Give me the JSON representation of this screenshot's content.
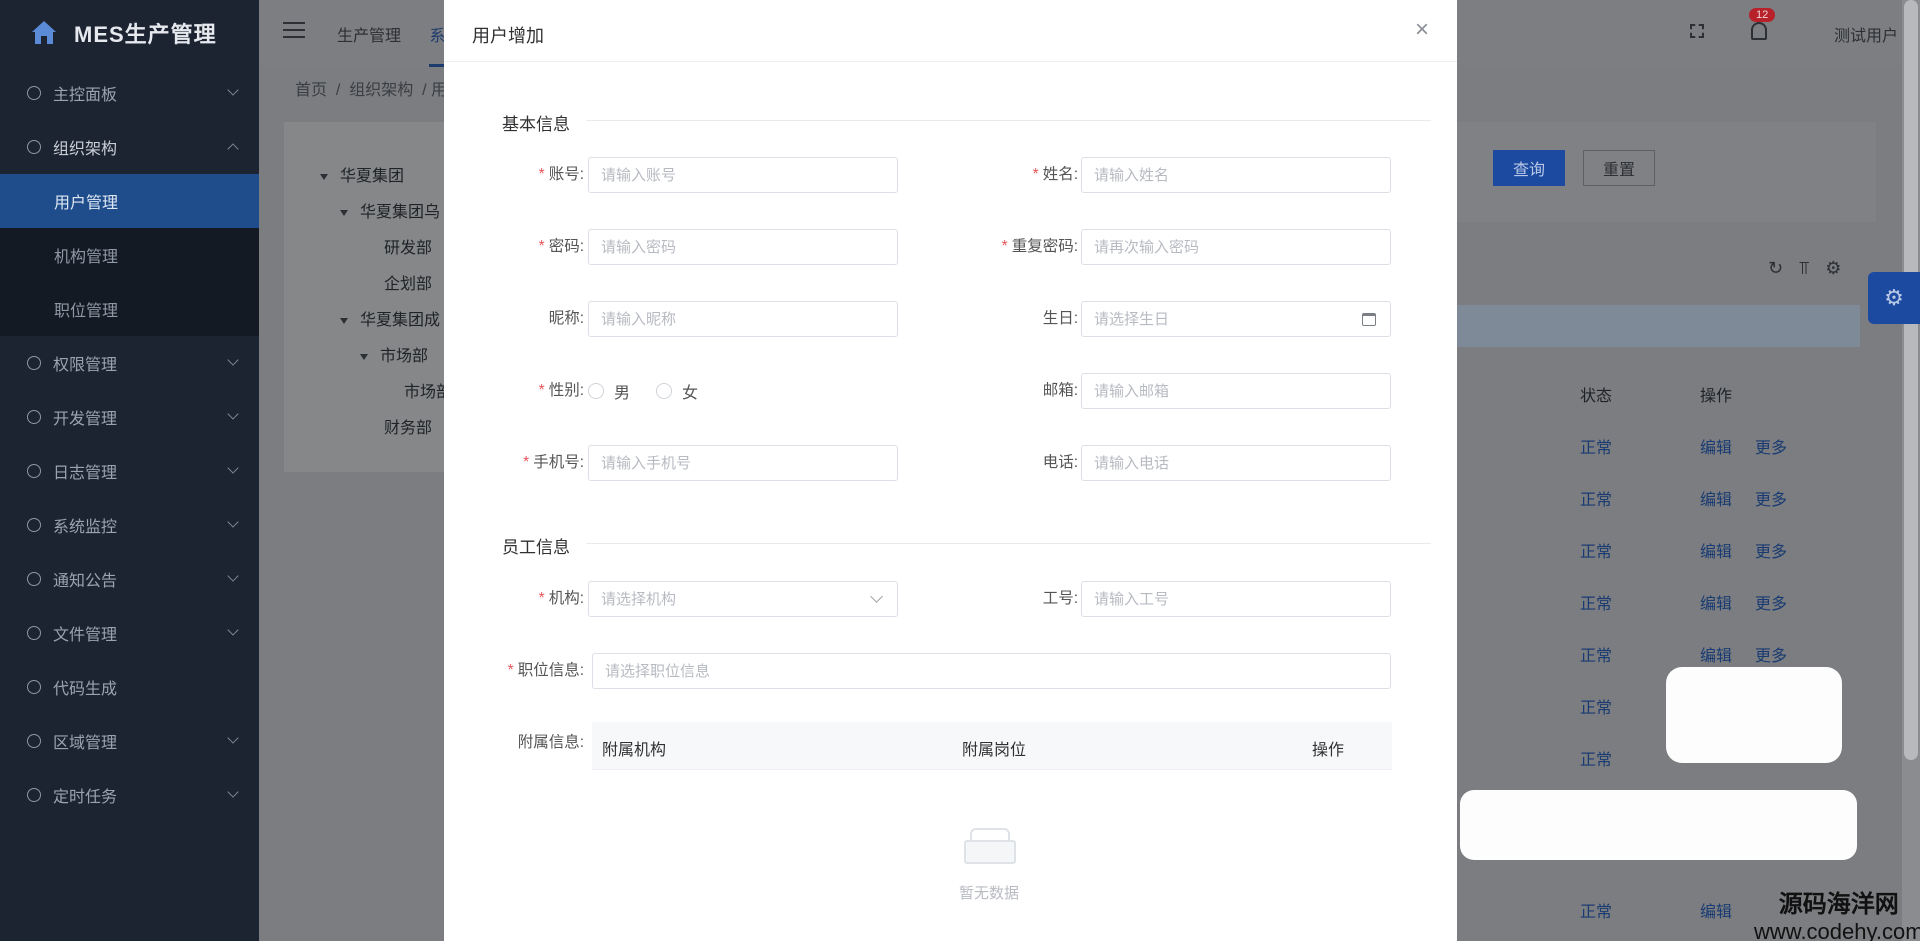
{
  "app": {
    "title": "MES生产管理"
  },
  "sidebar": {
    "items": [
      {
        "label": "主控面板",
        "icon": "dashboard-icon"
      },
      {
        "label": "组织架构",
        "icon": "org-icon",
        "open": true,
        "children": [
          {
            "label": "用户管理",
            "active": true
          },
          {
            "label": "机构管理"
          },
          {
            "label": "职位管理"
          }
        ]
      },
      {
        "label": "权限管理",
        "icon": "shield-icon"
      },
      {
        "label": "开发管理",
        "icon": "dev-icon"
      },
      {
        "label": "日志管理",
        "icon": "log-icon"
      },
      {
        "label": "系统监控",
        "icon": "monitor-icon"
      },
      {
        "label": "通知公告",
        "icon": "notice-icon"
      },
      {
        "label": "文件管理",
        "icon": "file-icon"
      },
      {
        "label": "代码生成",
        "icon": "code-icon"
      },
      {
        "label": "区域管理",
        "icon": "location-icon"
      },
      {
        "label": "定时任务",
        "icon": "clock-icon"
      }
    ]
  },
  "topbar": {
    "nav": [
      "生产管理",
      "系统"
    ],
    "badge_count": "12",
    "user": "测试用户"
  },
  "breadcrumb": {
    "home": "首页",
    "sep": "/",
    "current": "组织架构",
    "tail": "/  用"
  },
  "tree": [
    "华夏集团",
    "华夏集团乌",
    "研发部",
    "企划部",
    "华夏集团成",
    "市场部",
    "市场部",
    "财务部"
  ],
  "filter": {
    "query": "查询",
    "reset": "重置"
  },
  "table": {
    "status_header": "状态",
    "action_header": "操作",
    "status": "正常",
    "edit": "编辑",
    "more": "更多"
  },
  "watermark": {
    "line1": "源码海洋网",
    "line2": "www.codehy.com"
  },
  "modal": {
    "title": "用户增加",
    "close": "×",
    "sections": {
      "basic": "基本信息",
      "employee": "员工信息"
    },
    "fields": {
      "account": {
        "label": "账号:",
        "placeholder": "请输入账号"
      },
      "name": {
        "label": "姓名:",
        "placeholder": "请输入姓名"
      },
      "password": {
        "label": "密码:",
        "placeholder": "请输入密码"
      },
      "repeat_password": {
        "label": "重复密码:",
        "placeholder": "请再次输入密码"
      },
      "nickname": {
        "label": "昵称:",
        "placeholder": "请输入昵称"
      },
      "birthday": {
        "label": "生日:",
        "placeholder": "请选择生日"
      },
      "gender": {
        "label": "性别:",
        "male": "男",
        "female": "女"
      },
      "email": {
        "label": "邮箱:",
        "placeholder": "请输入邮箱"
      },
      "mobile": {
        "label": "手机号:",
        "placeholder": "请输入手机号"
      },
      "phone": {
        "label": "电话:",
        "placeholder": "请输入电话"
      },
      "org": {
        "label": "机构:",
        "placeholder": "请选择机构"
      },
      "job_no": {
        "label": "工号:",
        "placeholder": "请输入工号"
      },
      "position": {
        "label": "职位信息:",
        "placeholder": "请选择职位信息"
      },
      "extra": {
        "label": "附属信息:"
      }
    },
    "sub_table": {
      "col1": "附属机构",
      "col2": "附属岗位",
      "col3": "操作"
    },
    "empty_text": "暂无数据"
  },
  "colors": {
    "sidebar_bg": "#1c2431",
    "active_menu": "#1f4d8c",
    "primary": "#1c4aa0",
    "required": "#e4565b"
  }
}
